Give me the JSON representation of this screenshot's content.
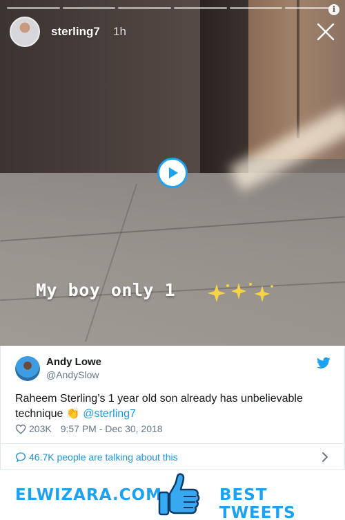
{
  "story": {
    "username": "sterling7",
    "time": "1h",
    "caption": "My boy only 1",
    "progress_segments": 6
  },
  "tweet": {
    "name": "Andy Lowe",
    "handle": "@AndySlow",
    "text": "Raheem Sterling’s 1 year old son already has unbelievable technique",
    "emoji": "👏",
    "mention": "@sterling7",
    "likes": "203K",
    "timestamp": "9:57 PM - Dec 30, 2018",
    "talking": "46.7K people are talking about this"
  },
  "footer": {
    "left_brand": "ELWIZARA.COM",
    "right_brand": "BEST TWEETS"
  },
  "colors": {
    "twitter_blue": "#1da1f2",
    "link_blue": "#1b95e0",
    "muted": "#657786"
  },
  "icons": [
    "close-icon",
    "info-icon",
    "play-icon",
    "twitter-bird-icon",
    "heart-icon",
    "speech-bubble-icon",
    "chevron-right-icon",
    "thumbs-up-icon",
    "sparkles-icon"
  ]
}
